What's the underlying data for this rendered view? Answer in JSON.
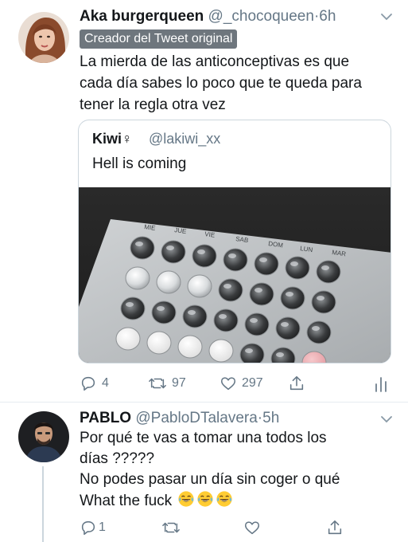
{
  "tweet1": {
    "display_name": "Aka burgerqueen",
    "handle": "@_chocoqueen",
    "separator": "·",
    "time": "6h",
    "badge": "Creador del Tweet original",
    "text_line1": "La mierda de las anticonceptivas es que",
    "text_line2": "cada día sabes lo poco que te queda para",
    "text_line3": "tener la regla otra vez",
    "quote": {
      "display_name": "Kiwi",
      "name_symbol": "♀",
      "handle": "@lakiwi_xx",
      "text": "Hell is coming",
      "photo_labels": [
        "MIE",
        "JUE",
        "VIE",
        "SAB",
        "DOM",
        "LUN",
        "MAR"
      ]
    },
    "actions": {
      "reply_count": "4",
      "retweet_count": "97",
      "like_count": "297"
    }
  },
  "tweet2": {
    "display_name": "PABLO",
    "handle": "@PabloDTalavera",
    "separator": "·",
    "time": "5h",
    "text_line1": "Por qué te vas a tomar una todos los",
    "text_line2": "días ?????",
    "text_line3": "No podes pasar un día sin coger o qué",
    "text_line4": "What the fuck",
    "emoji": [
      "laughing-tears-emoji",
      "laughing-tears-emoji",
      "laughing-tears-emoji"
    ],
    "actions": {
      "reply_count": "1"
    }
  },
  "colors": {
    "text": "#14171a",
    "secondary": "#657786",
    "border": "#ccd6dd",
    "badge_bg": "#6e767d"
  },
  "icons": [
    "reply-icon",
    "retweet-icon",
    "like-icon",
    "share-icon",
    "analytics-icon",
    "chevron-down-icon"
  ]
}
